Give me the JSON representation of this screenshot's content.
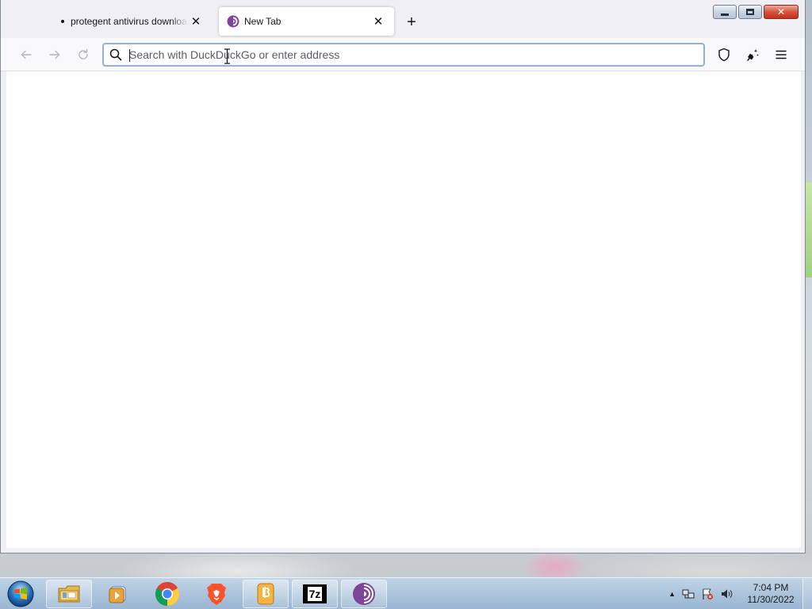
{
  "browser": {
    "tabs": [
      {
        "title": "protegent antivirus download and install",
        "active": false
      },
      {
        "title": "New Tab",
        "active": true
      }
    ],
    "new_tab_symbol": "+",
    "close_symbol": "✕",
    "urlbar": {
      "placeholder": "Search with DuckDuckGo or enter address",
      "value": ""
    },
    "toolbar_icons": [
      "shield-icon",
      "sparkle-broom-icon",
      "hamburger-menu-icon"
    ],
    "nav_icons": [
      "back-arrow-icon",
      "forward-arrow-icon",
      "reload-icon"
    ],
    "accent_color": "#8fb2d5"
  },
  "window_controls": {
    "minimize": "minimize",
    "maximize": "maximize",
    "close": "✕"
  },
  "taskbar": {
    "pinned": [
      "start-orb-icon",
      "file-explorer-icon",
      "media-player-icon",
      "chrome-icon",
      "brave-icon",
      "app-icon",
      "7zip-icon",
      "tor-browser-icon"
    ],
    "sevenzip_label": "7z",
    "tray_icons": [
      "show-hidden-arrow-icon",
      "network-icon",
      "flag-icon",
      "volume-icon"
    ],
    "clock": {
      "time": "7:04 PM",
      "date": "11/30/2022"
    }
  }
}
